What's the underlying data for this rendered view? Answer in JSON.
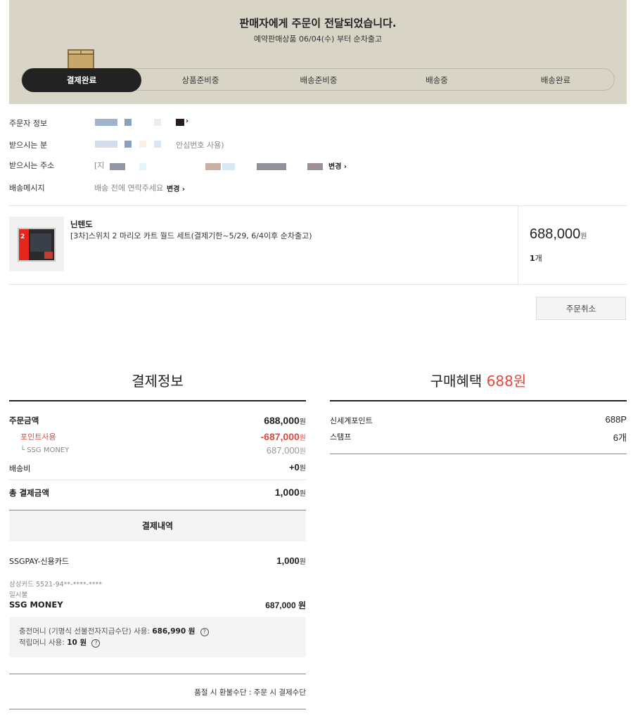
{
  "header": {
    "title": "판매자에게 주문이 전달되었습니다.",
    "subtitle": "예약판매상품 06/04(수) 부터 순차출고",
    "steps": [
      "결제완료",
      "상품준비중",
      "배송준비중",
      "배송중",
      "배송완료"
    ],
    "active_step": 0
  },
  "orderer": {
    "orderer_label": "주문자 정보",
    "recipient_label": "받으시는 분",
    "recipient_note": "안심번호 사용)",
    "address_label": "받으시는 주소",
    "address_prefix": "[지",
    "address_change": "변경",
    "message_label": "배송메시지",
    "message_value": "배송 전에 연락주세요",
    "message_change": "변경"
  },
  "product": {
    "brand": "닌텐도",
    "name": "[3차]스위치 2 마리오 카트 월드 세트(결제기한~5/29, 6/4이후 순차출고)",
    "price": "688,000",
    "price_unit": "원",
    "qty": "1",
    "qty_unit": "개",
    "thumb_badge": "2"
  },
  "cancel_button": "주문취소",
  "payment": {
    "title": "결제정보",
    "order_amount_label": "주문금액",
    "order_amount": "688,000",
    "point_label": "포인트사용",
    "point_amount": "-687,000",
    "ssg_money_label": "└ SSG MONEY",
    "ssg_money_amount": "687,000",
    "shipping_label": "배송비",
    "shipping_amount": "+0",
    "total_label": "총 결제금액",
    "total_amount": "1,000",
    "unit": "원",
    "details_title": "결제내역",
    "method1_label": "SSGPAY-신용카드",
    "method1_amount": "1,000",
    "card_info": "삼성카드 5521-94**-****-****",
    "installment": "일시불",
    "method2_label": "SSG MONEY",
    "method2_amount": "687,000 원",
    "charge_money_label": "충전머니 (기명식 선불전자지급수단) 사용:",
    "charge_money_amount": "686,990 원",
    "reward_money_label": "적립머니 사용:",
    "reward_money_amount": "10 원",
    "refund_note": "품절 시 환불수단 : 주문 시 결제수단"
  },
  "benefit": {
    "title": "구매혜택",
    "title_amount": "688원",
    "point_label": "신세계포인트",
    "point_value": "688P",
    "stamp_label": "스탬프",
    "stamp_value": "6개"
  },
  "colors": {
    "accent_red": "#e5483b",
    "hero_bg": "#d9d5c6",
    "dark": "#222222"
  }
}
